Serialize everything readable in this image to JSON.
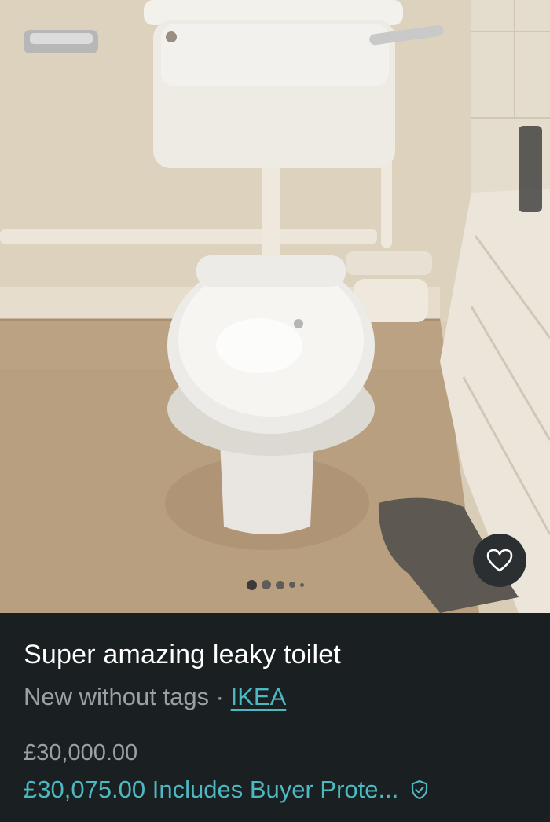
{
  "listing": {
    "title": "Super amazing leaky toilet",
    "condition": "New without tags",
    "separator": " · ",
    "brand": "IKEA",
    "price": "£30,000.00",
    "total_with_protection": "£30,075.00 Includes Buyer Prote..."
  },
  "gallery": {
    "photo_count": 5,
    "active_index": 0
  },
  "icons": {
    "favorite": "heart-icon",
    "protection": "shield-check-icon"
  },
  "colors": {
    "background": "#1a1f22",
    "accent": "#4cb8c0",
    "muted_text": "#9aa1a4",
    "primary_text": "#ffffff"
  }
}
